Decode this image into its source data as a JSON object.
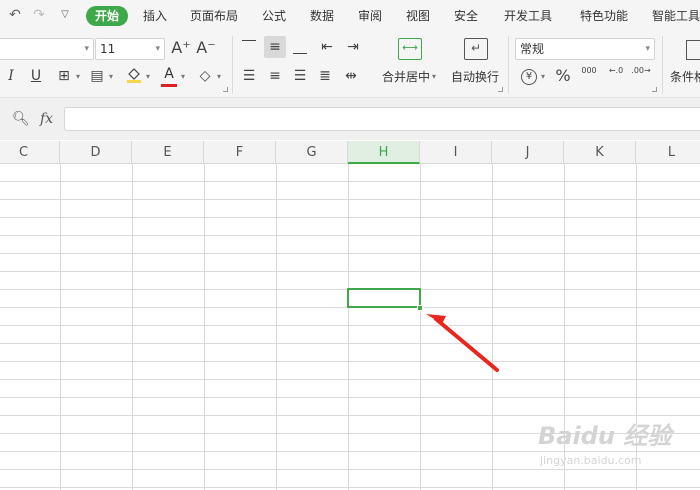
{
  "quick_access": {
    "undo_icon": "undo-icon",
    "redo_icon": "redo-icon",
    "more_icon": "chevron-down-icon"
  },
  "menu_tabs": [
    {
      "label": "开始",
      "active": true
    },
    {
      "label": "插入"
    },
    {
      "label": "页面布局"
    },
    {
      "label": "公式"
    },
    {
      "label": "数据"
    },
    {
      "label": "审阅"
    },
    {
      "label": "视图"
    },
    {
      "label": "安全"
    },
    {
      "label": "开发工具"
    },
    {
      "label": "特色功能"
    },
    {
      "label": "智能工具"
    }
  ],
  "ribbon": {
    "font_name": "",
    "font_size": "11",
    "increase_font": "A⁺",
    "decrease_font": "A⁻",
    "italic": "I",
    "underline": "U",
    "font_color_letter": "A",
    "merge_center_label": "合并居中",
    "wrap_text_label": "自动换行",
    "number_format": "常规",
    "currency_symbol": "¥",
    "percent_symbol": "%",
    "thousands_symbol": "000",
    "increase_decimal": "←.0",
    "decrease_decimal": ".00→",
    "conditional_format_label": "条件格式",
    "colors": {
      "accent": "#3fa84a",
      "font_color": "#e02020",
      "fill_color": "#f5d84a"
    }
  },
  "formula_bar": {
    "zoom_icon": "zoom-icon",
    "fx_label": "fx",
    "value": ""
  },
  "columns": [
    "C",
    "D",
    "E",
    "F",
    "G",
    "H",
    "I",
    "J",
    "K",
    "L"
  ],
  "selected_column": "H",
  "selection": {
    "cell": "H8",
    "color": "#3fa84a"
  },
  "watermark": {
    "main": "Baidu 经验",
    "sub": "jingyan.baidu.com"
  }
}
